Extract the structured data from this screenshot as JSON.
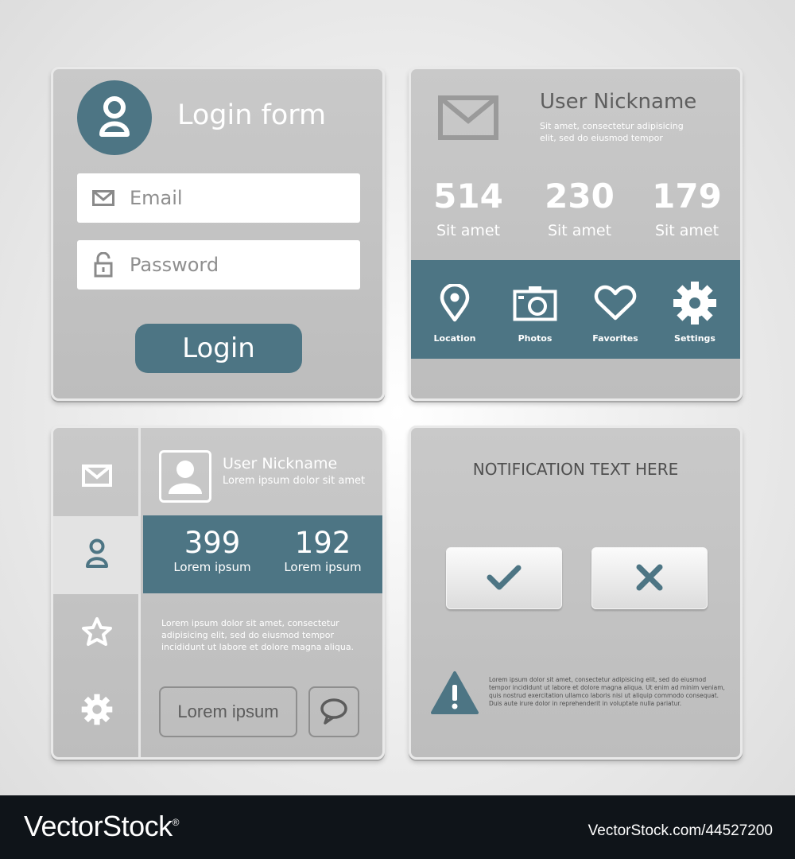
{
  "colors": {
    "accent": "#4d7584",
    "panel": "#c3c3c3",
    "footer_bg": "#0f1419"
  },
  "login": {
    "title": "Login form",
    "email_placeholder": "Email",
    "password_placeholder": "Password",
    "button_label": "Login",
    "icons": [
      "user-icon",
      "envelope-icon",
      "unlock-icon"
    ]
  },
  "profile": {
    "nickname": "User Nickname",
    "subtitle_line1": "Sit amet, consectetur adipisicing",
    "subtitle_line2": "elit, sed do eiusmod tempor",
    "stats": [
      {
        "value": "514",
        "label": "Sit amet"
      },
      {
        "value": "230",
        "label": "Sit amet"
      },
      {
        "value": "179",
        "label": "Sit amet"
      }
    ],
    "menu": [
      {
        "label": "Location",
        "icon": "location-pin-icon"
      },
      {
        "label": "Photos",
        "icon": "camera-icon"
      },
      {
        "label": "Favorites",
        "icon": "heart-icon"
      },
      {
        "label": "Settings",
        "icon": "gear-icon"
      }
    ]
  },
  "sidebar_card": {
    "nickname": "User Nickname",
    "subtitle": "Lorem ipsum dolor sit amet",
    "sidebar_icons": [
      "envelope-icon",
      "user-icon",
      "star-icon",
      "gear-icon"
    ],
    "stats": [
      {
        "value": "399",
        "label": "Lorem ipsum"
      },
      {
        "value": "192",
        "label": "Lorem ipsum"
      }
    ],
    "paragraph": "Lorem ipsum dolor sit amet, consectetur adipisicing elit, sed do eiusmod tempor incididunt ut labore et dolore magna aliqua.",
    "button_label": "Lorem ipsum"
  },
  "notification": {
    "title": "NOTIFICATION TEXT HERE",
    "warning_text": "Lorem ipsum dolor sit amet, consectetur adipisicing elit, sed do eiusmod tempor incididunt ut labore et dolore magna aliqua. Ut enim ad minim veniam, quis nostrud exercitation ullamco laboris nisi ut aliquip commodo consequat. Duis aute irure dolor in reprehenderit in voluptate nulla pariatur."
  },
  "footer": {
    "brand": "VectorStock",
    "registered": "®",
    "image_id": "VectorStock.com/44527200"
  }
}
